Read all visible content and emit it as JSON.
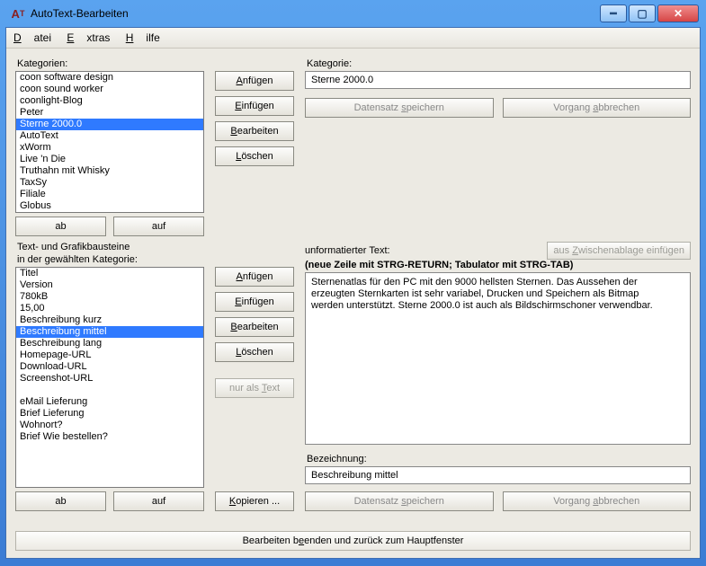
{
  "titlebar": {
    "title": "AutoText-Bearbeiten"
  },
  "menu": {
    "datei": "Datei",
    "extras": "Extras",
    "hilfe": "Hilfe"
  },
  "labels": {
    "kategorien": "Kategorien:",
    "textbausteine_l1": "Text- und Grafikbausteine",
    "textbausteine_l2": "in der gewählten Kategorie:",
    "kategorie": "Kategorie:",
    "unformatierter": "unformatierter Text:",
    "hint": "(neue Zeile mit STRG-RETURN;   Tabulator mit STRG-TAB)",
    "bezeichnung": "Bezeichnung:"
  },
  "lists": {
    "categories": [
      "coon software design",
      "coon sound worker",
      "coonlight-Blog",
      "Peter",
      "Sterne 2000.0",
      "AutoText",
      "xWorm",
      "Live 'n Die",
      "Truthahn mit Whisky",
      "TaxSy",
      "Filiale",
      "Globus"
    ],
    "categories_selected_index": 4,
    "items": [
      "Titel",
      "Version",
      "780kB",
      "15,00",
      "Beschreibung kurz",
      "Beschreibung mittel",
      "Beschreibung lang",
      "Homepage-URL",
      "Download-URL",
      "Screenshot-URL",
      "",
      "eMail Lieferung",
      "Brief Lieferung",
      "Wohnort?",
      "Brief Wie bestellen?"
    ],
    "items_selected_index": 5
  },
  "buttons": {
    "anfuegen": "Anfügen",
    "einfuegen": "Einfügen",
    "bearbeiten": "Bearbeiten",
    "loeschen": "Löschen",
    "ab": "ab",
    "auf": "auf",
    "nur_als_text": "nur als Text",
    "kopieren": "Kopieren ...",
    "clipboard": "aus Zwischenablage einfügen",
    "datensatz_speichern": "Datensatz speichern",
    "vorgang_abbrechen": "Vorgang abbrechen",
    "bottom": "Bearbeiten beenden und zurück zum Hauptfenster"
  },
  "fields": {
    "kategorie_value": "Sterne 2000.0",
    "bezeichnung_value": "Beschreibung mittel",
    "text_value": "Sternenatlas für den PC mit den 9000 hellsten Sternen. Das Aussehen der erzeugten Sternkarten ist sehr variabel, Drucken und Speichern als Bitmap werden unterstützt. Sterne 2000.0 ist auch als Bildschirmschoner verwendbar."
  }
}
